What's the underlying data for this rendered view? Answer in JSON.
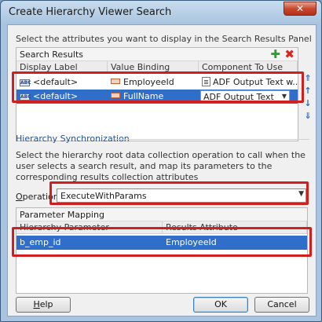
{
  "window": {
    "title": "Create Hierarchy Viewer Search",
    "close_glyph": "✕"
  },
  "instruction": "Select the attributes you want to display in the Search Results Panel",
  "search_results": {
    "title": "Search Results",
    "columns": [
      "Display Label",
      "Value Binding",
      "Component To Use"
    ],
    "rows": [
      {
        "label": "<default>",
        "binding": "EmployeeId",
        "component": "ADF Output Text w...",
        "selected": false
      },
      {
        "label": "<default>",
        "binding": "FullName",
        "component": "ADF Output Text",
        "selected": true
      }
    ]
  },
  "side_icons": [
    "move-top-icon",
    "move-up-icon",
    "move-down-icon",
    "move-bottom-icon"
  ],
  "hierarchy_sync": {
    "title": "Hierarchy Synchronization",
    "description": "Select the hierarchy root data collection operation to call when the user selects a search result, and map its parameters to the corresponding results collection attributes",
    "operation_label": "Operation",
    "operation_value": "ExecuteWithParams"
  },
  "parameter_mapping": {
    "title": "Parameter Mapping",
    "columns": [
      "Hierarchy Parameter",
      "Results Attribute"
    ],
    "rows": [
      {
        "param": "b_emp_id",
        "attribute": "EmployeeId"
      }
    ]
  },
  "buttons": {
    "help": "Help",
    "ok": "OK",
    "cancel": "Cancel"
  },
  "colors": {
    "selection": "#2f6ec9",
    "highlight": "#d11e1e",
    "section_title": "#1f4e9a"
  }
}
